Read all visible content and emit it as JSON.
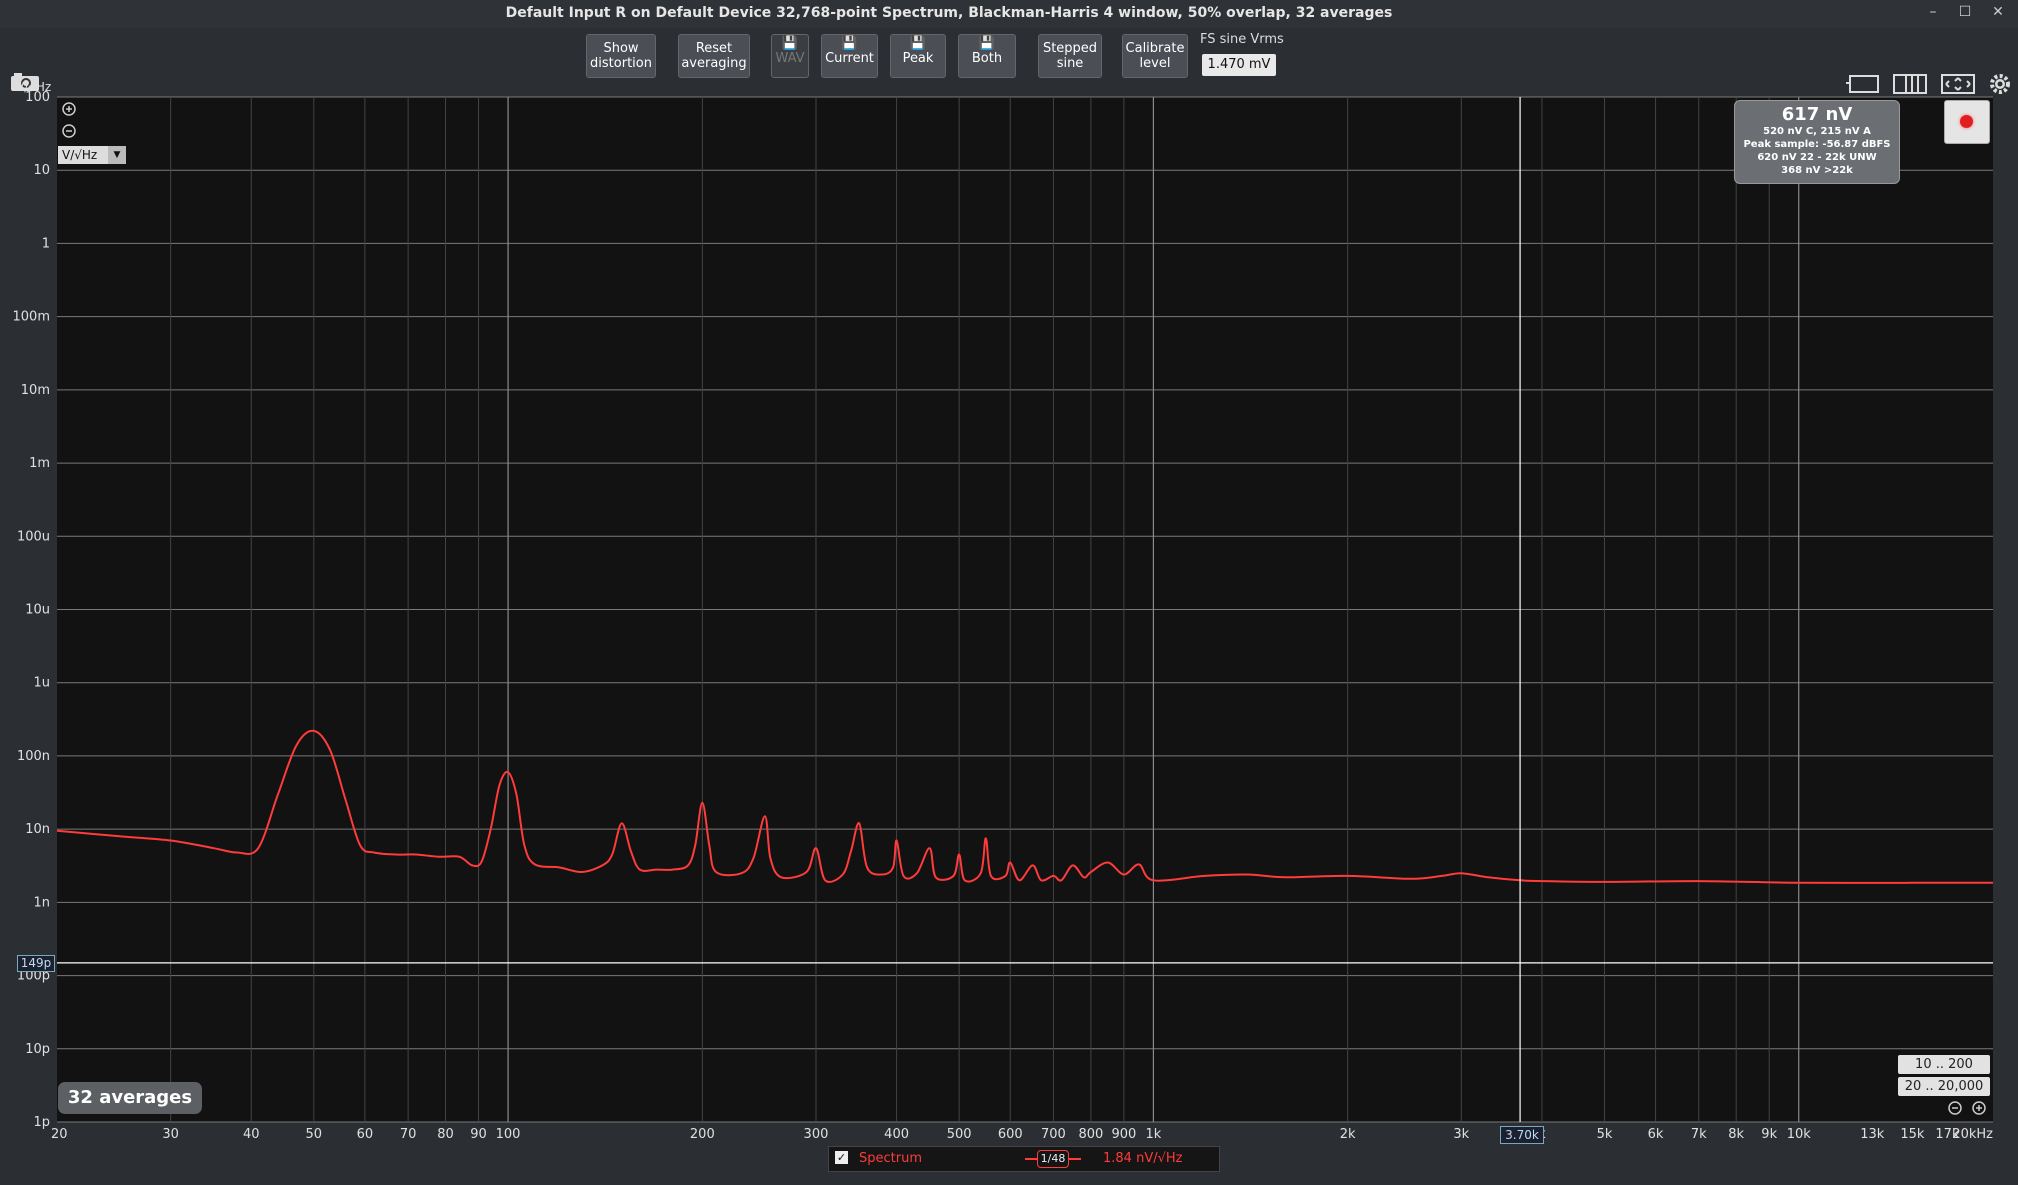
{
  "window": {
    "title": "Default Input R on Default Device 32,768-point Spectrum, Blackman-Harris 4 window, 50% overlap, 32 averages",
    "minimize": "–",
    "maximize": "☐",
    "close": "✕"
  },
  "toolbar": {
    "show_distortion": "Show\ndistortion",
    "reset_averaging": "Reset\naveraging",
    "wav": "WAV",
    "current": "Current",
    "peak": "Peak",
    "both": "Both",
    "stepped_sine": "Stepped\nsine",
    "calibrate_level": "Calibrate\nlevel",
    "fs_label": "FS sine Vrms",
    "fs_value": "1.470 mV",
    "save_icon": "💾"
  },
  "readout": {
    "main": "617 nV",
    "line1": "520 nV C, 215 nV A",
    "line2": "Peak sample: -56.87 dBFS",
    "line3": "620 nV 22 - 22k UNW",
    "line4": "368 nV >22k"
  },
  "unit_selector": "V/√Hz",
  "averages_badge": "32 averages",
  "range_buttons": [
    "10 .. 200",
    "20 .. 20,000"
  ],
  "cursor": {
    "x_label": "3.70k",
    "y_label": "149p"
  },
  "legend": {
    "checkbox": "✓",
    "name": "Spectrum",
    "smoothing": "1/48",
    "value": "1.84 nV/√Hz",
    "color": "#ff3b3b"
  },
  "chart_data": {
    "type": "line",
    "ylabel": "V/√Hz",
    "x_scale": "log",
    "y_scale": "log",
    "xlim": [
      20,
      20000
    ],
    "ylim": [
      1e-12,
      100
    ],
    "y_ticks": [
      {
        "v": 100,
        "label": "100"
      },
      {
        "v": 10,
        "label": "10"
      },
      {
        "v": 1,
        "label": "1"
      },
      {
        "v": 0.1,
        "label": "100m"
      },
      {
        "v": 0.01,
        "label": "10m"
      },
      {
        "v": 0.001,
        "label": "1m"
      },
      {
        "v": 0.0001,
        "label": "100u"
      },
      {
        "v": 1e-05,
        "label": "10u"
      },
      {
        "v": 1e-06,
        "label": "1u"
      },
      {
        "v": 1e-07,
        "label": "100n"
      },
      {
        "v": 1e-08,
        "label": "10n"
      },
      {
        "v": 1e-09,
        "label": "1n"
      },
      {
        "v": 1e-10,
        "label": "100p"
      },
      {
        "v": 1e-11,
        "label": "10p"
      },
      {
        "v": 1e-12,
        "label": "1p"
      }
    ],
    "x_ticks": [
      {
        "v": 20,
        "label": "20"
      },
      {
        "v": 30,
        "label": "30"
      },
      {
        "v": 40,
        "label": "40"
      },
      {
        "v": 50,
        "label": "50"
      },
      {
        "v": 60,
        "label": "60"
      },
      {
        "v": 70,
        "label": "70"
      },
      {
        "v": 80,
        "label": "80"
      },
      {
        "v": 90,
        "label": "90"
      },
      {
        "v": 100,
        "label": "100"
      },
      {
        "v": 200,
        "label": "200"
      },
      {
        "v": 300,
        "label": "300"
      },
      {
        "v": 400,
        "label": "400"
      },
      {
        "v": 500,
        "label": "500"
      },
      {
        "v": 600,
        "label": "600"
      },
      {
        "v": 700,
        "label": "700"
      },
      {
        "v": 800,
        "label": "800"
      },
      {
        "v": 900,
        "label": "900"
      },
      {
        "v": 1000,
        "label": "1k"
      },
      {
        "v": 2000,
        "label": "2k"
      },
      {
        "v": 3000,
        "label": "3k"
      },
      {
        "v": 4000,
        "label": "k"
      },
      {
        "v": 5000,
        "label": "5k"
      },
      {
        "v": 6000,
        "label": "6k"
      },
      {
        "v": 7000,
        "label": "7k"
      },
      {
        "v": 8000,
        "label": "8k"
      },
      {
        "v": 9000,
        "label": "9k"
      },
      {
        "v": 10000,
        "label": "10k"
      },
      {
        "v": 13000,
        "label": "13k"
      },
      {
        "v": 15000,
        "label": "15k"
      },
      {
        "v": 17000,
        "label": "17k"
      },
      {
        "v": 20000,
        "label": "20kHz"
      }
    ],
    "major_x": [
      100,
      1000,
      10000
    ],
    "cursor_x": 3700,
    "cursor_y": 1.49e-10,
    "series": [
      {
        "color": "#ff3b3b",
        "points": [
          [
            20,
            9.5e-09
          ],
          [
            25,
            8e-09
          ],
          [
            30,
            7e-09
          ],
          [
            35,
            5.5e-09
          ],
          [
            38,
            4.8e-09
          ],
          [
            41,
            5.5e-09
          ],
          [
            44,
            3e-08
          ],
          [
            47,
            1.4e-07
          ],
          [
            50,
            2.2e-07
          ],
          [
            53,
            1.2e-07
          ],
          [
            56,
            2.5e-08
          ],
          [
            59,
            6e-09
          ],
          [
            62,
            4.8e-09
          ],
          [
            67,
            4.5e-09
          ],
          [
            72,
            4.5e-09
          ],
          [
            78,
            4.2e-09
          ],
          [
            84,
            4.2e-09
          ],
          [
            88,
            3.2e-09
          ],
          [
            91,
            3.6e-09
          ],
          [
            94,
            1e-08
          ],
          [
            97,
            4e-08
          ],
          [
            100,
            6e-08
          ],
          [
            103,
            3e-08
          ],
          [
            106,
            6e-09
          ],
          [
            110,
            3.3e-09
          ],
          [
            120,
            3e-09
          ],
          [
            130,
            2.6e-09
          ],
          [
            140,
            3.2e-09
          ],
          [
            145,
            4.5e-09
          ],
          [
            150,
            1.2e-08
          ],
          [
            155,
            5e-09
          ],
          [
            160,
            2.8e-09
          ],
          [
            170,
            2.8e-09
          ],
          [
            180,
            2.8e-09
          ],
          [
            190,
            3.2e-09
          ],
          [
            195,
            6e-09
          ],
          [
            200,
            2.3e-08
          ],
          [
            205,
            6e-09
          ],
          [
            210,
            2.6e-09
          ],
          [
            230,
            2.5e-09
          ],
          [
            240,
            4e-09
          ],
          [
            250,
            1.5e-08
          ],
          [
            255,
            4e-09
          ],
          [
            265,
            2.2e-09
          ],
          [
            290,
            2.6e-09
          ],
          [
            300,
            5.5e-09
          ],
          [
            310,
            2e-09
          ],
          [
            330,
            2.4e-09
          ],
          [
            340,
            5e-09
          ],
          [
            350,
            1.2e-08
          ],
          [
            360,
            3e-09
          ],
          [
            380,
            2.4e-09
          ],
          [
            395,
            3e-09
          ],
          [
            400,
            7e-09
          ],
          [
            410,
            2.3e-09
          ],
          [
            430,
            2.5e-09
          ],
          [
            450,
            5.5e-09
          ],
          [
            460,
            2.2e-09
          ],
          [
            490,
            2.3e-09
          ],
          [
            500,
            4.5e-09
          ],
          [
            510,
            2e-09
          ],
          [
            540,
            2.5e-09
          ],
          [
            550,
            7.5e-09
          ],
          [
            560,
            2.3e-09
          ],
          [
            590,
            2.3e-09
          ],
          [
            600,
            3.5e-09
          ],
          [
            620,
            2e-09
          ],
          [
            650,
            3.2e-09
          ],
          [
            670,
            2e-09
          ],
          [
            700,
            2.3e-09
          ],
          [
            720,
            2e-09
          ],
          [
            750,
            3.2e-09
          ],
          [
            780,
            2.2e-09
          ],
          [
            800,
            2.6e-09
          ],
          [
            850,
            3.5e-09
          ],
          [
            900,
            2.4e-09
          ],
          [
            950,
            3.3e-09
          ],
          [
            1000,
            2e-09
          ],
          [
            1200,
            2.3e-09
          ],
          [
            1400,
            2.4e-09
          ],
          [
            1600,
            2.2e-09
          ],
          [
            2000,
            2.3e-09
          ],
          [
            2500,
            2.1e-09
          ],
          [
            2800,
            2.3e-09
          ],
          [
            3000,
            2.5e-09
          ],
          [
            3300,
            2.2e-09
          ],
          [
            3700,
            2e-09
          ],
          [
            4000,
            1.95e-09
          ],
          [
            5000,
            1.9e-09
          ],
          [
            7000,
            1.95e-09
          ],
          [
            10000,
            1.85e-09
          ],
          [
            15000,
            1.85e-09
          ],
          [
            20000,
            1.85e-09
          ]
        ]
      }
    ]
  }
}
